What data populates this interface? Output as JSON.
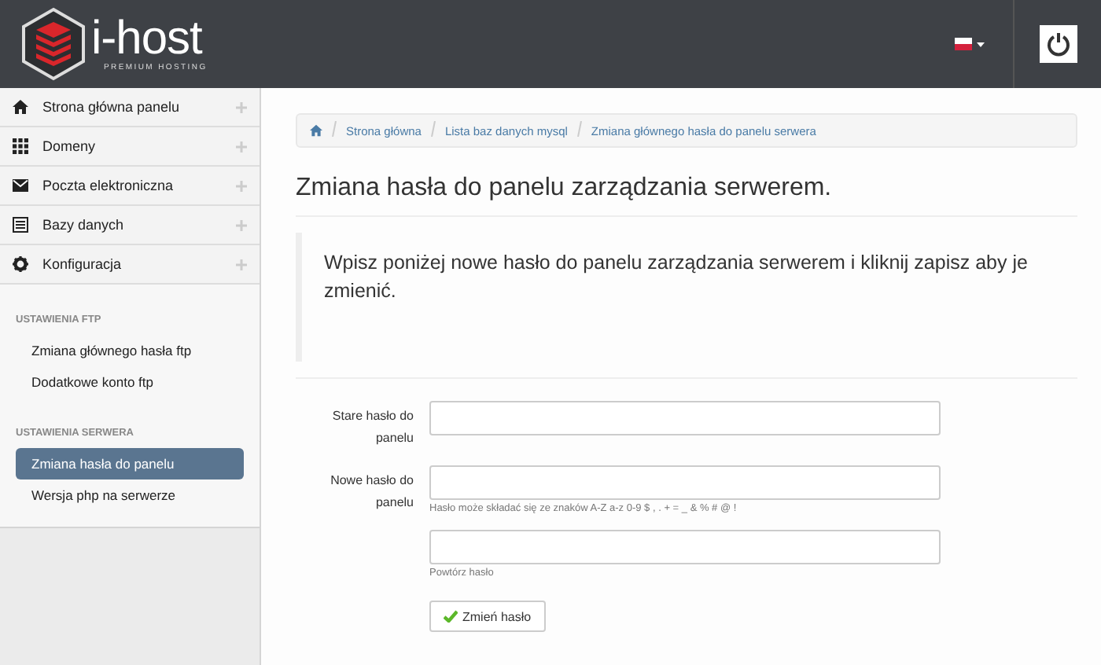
{
  "header": {
    "logo_text": "i-host",
    "logo_tagline": "PREMIUM HOSTING"
  },
  "sidebar": {
    "menu": [
      {
        "label": "Strona główna panelu"
      },
      {
        "label": "Domeny"
      },
      {
        "label": "Poczta elektroniczna"
      },
      {
        "label": "Bazy danych"
      },
      {
        "label": "Konfiguracja"
      }
    ],
    "sections": [
      {
        "title": "USTAWIENIA FTP",
        "items": [
          {
            "label": "Zmiana głównego hasła ftp",
            "selected": false
          },
          {
            "label": "Dodatkowe konto ftp",
            "selected": false
          }
        ]
      },
      {
        "title": "USTAWIENIA SERWERA",
        "items": [
          {
            "label": "Zmiana hasła do panelu",
            "selected": true
          },
          {
            "label": "Wersja php na serwerze",
            "selected": false
          }
        ]
      }
    ]
  },
  "breadcrumb": [
    "Strona główna",
    "Lista baz danych mysql",
    "Zmiana głównego hasła do panelu serwera"
  ],
  "page_title": "Zmiana hasła do panelu zarządzania serwerem.",
  "info": "Wpisz poniżej nowe hasło do panelu zarządzania serwerem i kliknij zapisz aby je zmienić.",
  "form": {
    "fields": [
      {
        "label": "Stare hasło do panelu"
      },
      {
        "label": "Nowe hasło do panelu",
        "help": "Hasło może składać się ze znaków A-Z a-z 0-9 $ , . + = _ & % # @ !"
      },
      {
        "help": "Powtórz hasło"
      }
    ],
    "submit": "Zmień hasło"
  }
}
